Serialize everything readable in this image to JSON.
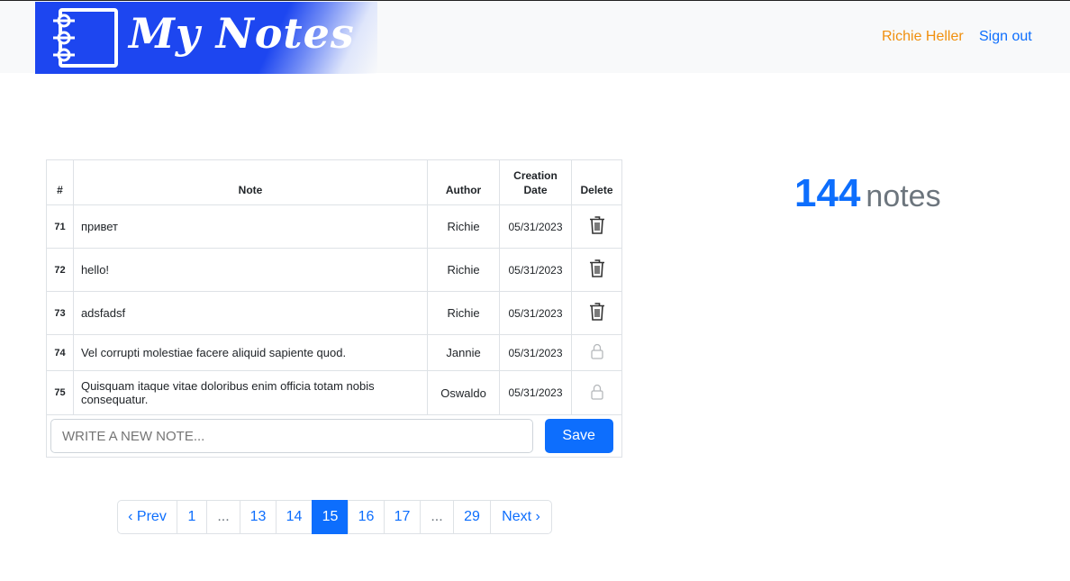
{
  "app": {
    "logo_text": "My Notes"
  },
  "nav": {
    "user_name": "Richie Heller",
    "sign_out": "Sign out"
  },
  "table": {
    "headers": {
      "num": "#",
      "note": "Note",
      "author": "Author",
      "date_line1": "Creation",
      "date_line2": "Date",
      "delete": "Delete"
    },
    "rows": [
      {
        "num": "71",
        "note": "привет",
        "author": "Richie",
        "date": "05/31/2023",
        "action": "trash-icon"
      },
      {
        "num": "72",
        "note": "hello!",
        "author": "Richie",
        "date": "05/31/2023",
        "action": "trash-icon"
      },
      {
        "num": "73",
        "note": "adsfadsf",
        "author": "Richie",
        "date": "05/31/2023",
        "action": "trash-icon"
      },
      {
        "num": "74",
        "note": "Vel corrupti molestiae facere aliquid sapiente quod.",
        "author": "Jannie",
        "date": "05/31/2023",
        "action": "lock-icon"
      },
      {
        "num": "75",
        "note": "Quisquam itaque vitae doloribus enim officia totam nobis consequatur.",
        "author": "Oswaldo",
        "date": "05/31/2023",
        "action": "lock-icon"
      }
    ]
  },
  "form": {
    "placeholder": "WRITE A NEW NOTE...",
    "save_label": "Save"
  },
  "stats": {
    "count": "144",
    "label": "notes"
  },
  "pagination": {
    "items": [
      "‹ Prev",
      "1",
      "...",
      "13",
      "14",
      "15",
      "16",
      "17",
      "...",
      "29",
      "Next ›"
    ],
    "current": "15"
  },
  "colors": {
    "primary": "#0d6efd",
    "user_name": "#f0900f",
    "logo_bg": "#1d46f0"
  }
}
